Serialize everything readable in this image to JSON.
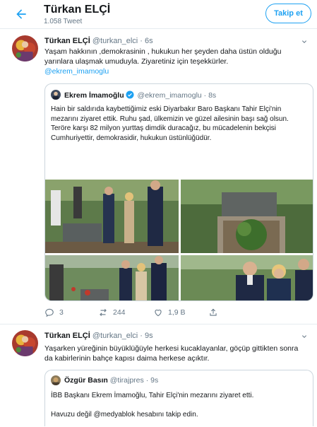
{
  "header": {
    "title": "Türkan ELÇİ",
    "tweet_count": "1.058 Tweet",
    "follow_label": "Takip et"
  },
  "tweets": [
    {
      "name": "Türkan ELÇİ",
      "handle": "@turkan_elci",
      "time": "· 6s",
      "text": "Yaşam hakkının ,demokrasinin , hukukun her şeyden daha üstün olduğu yarınlara ulaşmak umuduyla. Ziyaretiniz için teşekkürler.",
      "mention": "@ekrem_imamoglu",
      "quote": {
        "name": "Ekrem İmamoğlu",
        "handle": "@ekrem_imamoglu",
        "time": "· 8s",
        "text": "Hain bir saldırıda kaybettiğimiz eski Diyarbakır Baro Başkanı Tahir Elçi'nin mezarını ziyaret ettik. Ruhu şad, ülkemizin ve güzel ailesinin başı sağ olsun. Teröre karşı 82 milyon yurttaş dimdik duracağız, bu mücadelenin bekçisi Cumhuriyettir, demokrasidir, hukukun üstünlüğüdür."
      },
      "replies": "3",
      "retweets": "244",
      "likes": "1,9 B"
    },
    {
      "name": "Türkan ELÇİ",
      "handle": "@turkan_elci",
      "time": "· 9s",
      "text": "Yaşarken yüreğinin büyüklüğüyle herkesi kucaklayanlar, göçüp gittikten sonra da kabirlerinin bahçe kapısı daima herkese açıktır.",
      "quote": {
        "name": "Özgür Basın",
        "handle": "@tirajpres",
        "time": "· 9s",
        "line1": "İBB Başkanı Ekrem İmamoğlu, Tahir Elçi'nin mezarını ziyaret etti.",
        "line2": "Havuzu değil @medyablok hesabını takip edin."
      }
    }
  ],
  "colors": {
    "accent": "#1da1f2",
    "text": "#14171a",
    "muted": "#657786",
    "border": "#e6ecf0"
  }
}
